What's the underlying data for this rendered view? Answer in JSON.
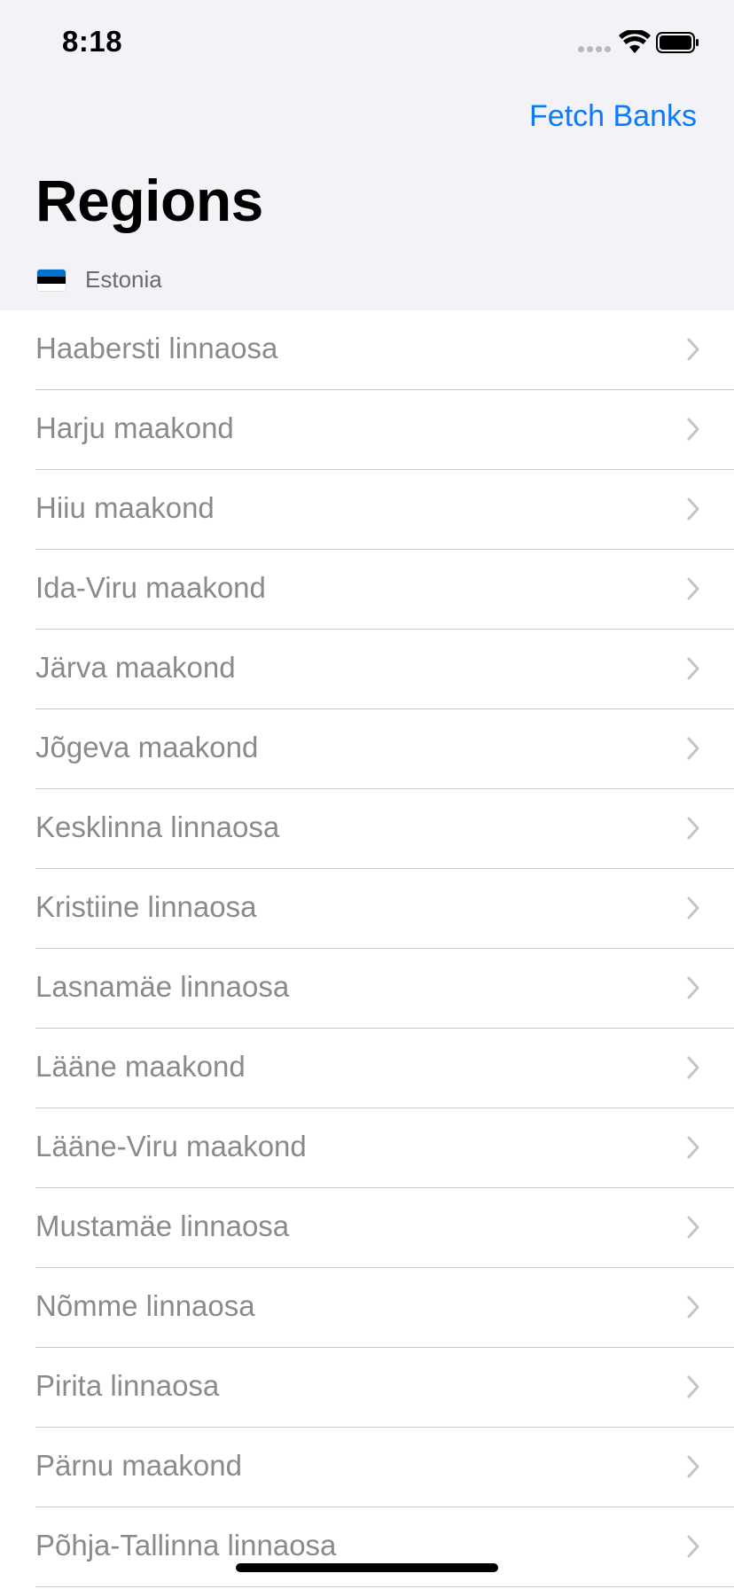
{
  "status_bar": {
    "time": "8:18"
  },
  "nav": {
    "fetch_button_label": "Fetch Banks",
    "title": "Regions",
    "country_label": "Estonia",
    "flag_icon": "estonia-flag-icon"
  },
  "regions": [
    {
      "label": "Haabersti linnaosa"
    },
    {
      "label": "Harju maakond"
    },
    {
      "label": "Hiiu maakond"
    },
    {
      "label": "Ida-Viru maakond"
    },
    {
      "label": "Järva maakond"
    },
    {
      "label": "Jõgeva maakond"
    },
    {
      "label": "Kesklinna linnaosa"
    },
    {
      "label": "Kristiine linnaosa"
    },
    {
      "label": "Lasnamäe linnaosa"
    },
    {
      "label": "Lääne maakond"
    },
    {
      "label": "Lääne-Viru maakond"
    },
    {
      "label": "Mustamäe linnaosa"
    },
    {
      "label": "Nõmme linnaosa"
    },
    {
      "label": "Pirita linnaosa"
    },
    {
      "label": "Pärnu maakond"
    },
    {
      "label": "Põhja-Tallinna linnaosa"
    }
  ],
  "colors": {
    "accent": "#0a7aff",
    "nav_background": "#f2f2f7",
    "row_text": "#8a8a8e"
  }
}
